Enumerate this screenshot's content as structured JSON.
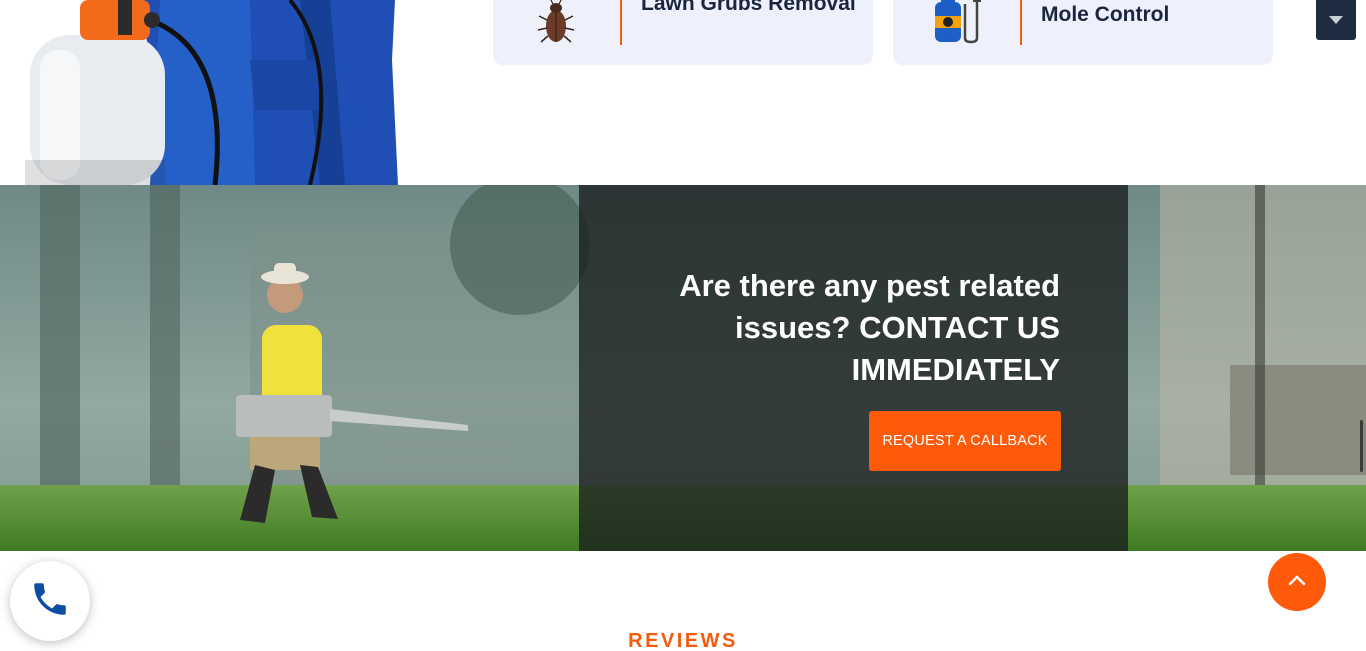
{
  "services": [
    {
      "label": "Lawn Grubs Removal",
      "icon": "beetle-icon"
    },
    {
      "label": "Mole Control",
      "icon": "sprayer-bottle-icon"
    }
  ],
  "dropdown": {
    "icon": "caret-down-icon"
  },
  "cta": {
    "heading": "Are there any pest related issues? CONTACT US IMMEDIATELY",
    "button_label": "REQUEST A CALLBACK"
  },
  "reviews": {
    "label": "REVIEWS"
  },
  "floating": {
    "call_icon": "phone-icon",
    "top_icon": "chevron-up-icon"
  },
  "colors": {
    "accent": "#ff5a0a",
    "navy": "#1a2540",
    "card_bg": "#eef1fb",
    "overlay": "#181e1e"
  }
}
